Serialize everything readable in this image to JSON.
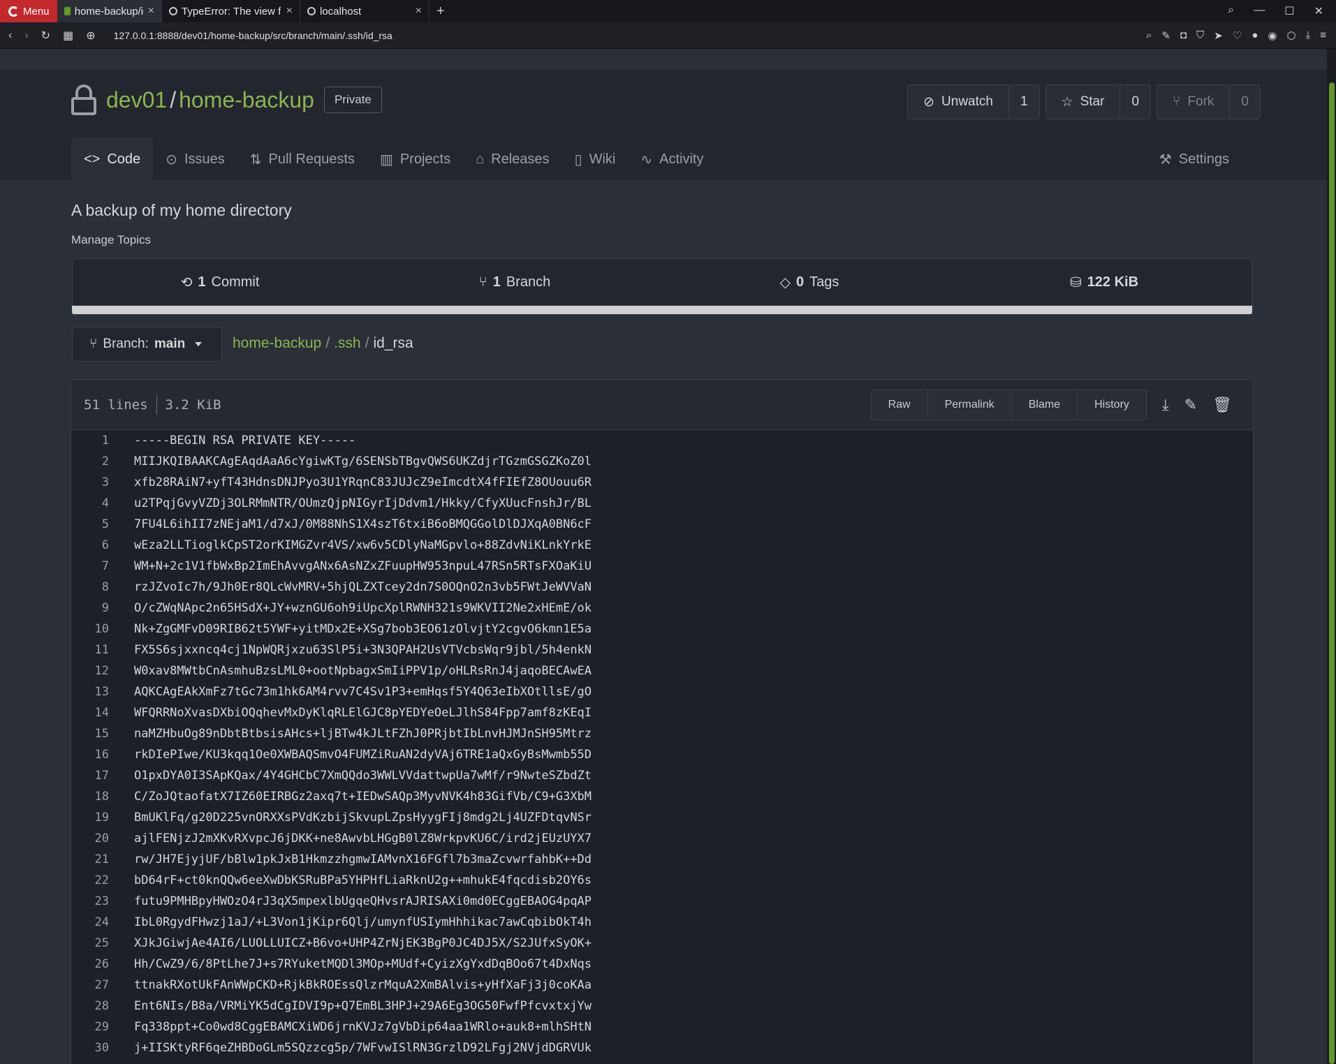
{
  "browser": {
    "menu_label": "Menu",
    "tabs": [
      {
        "title": "home-backup/id_rsa"
      },
      {
        "title": "TypeError: The view f"
      },
      {
        "title": "localhost"
      }
    ],
    "url": "127.0.0.1:8888/dev01/home-backup/src/branch/main/.ssh/id_rsa"
  },
  "repo": {
    "owner": "dev01",
    "name": "home-backup",
    "visibility": "Private",
    "unwatch_label": "Unwatch",
    "watch_count": "1",
    "star_label": "Star",
    "star_count": "0",
    "fork_label": "Fork",
    "fork_count": "0",
    "description": "A backup of my home directory",
    "manage_topics": "Manage Topics"
  },
  "nav": {
    "code": "Code",
    "issues": "Issues",
    "pulls": "Pull Requests",
    "projects": "Projects",
    "releases": "Releases",
    "wiki": "Wiki",
    "activity": "Activity",
    "settings": "Settings"
  },
  "stats": {
    "commits_num": "1",
    "commits_label": "Commit",
    "branches_num": "1",
    "branches_label": "Branch",
    "tags_num": "0",
    "tags_label": "Tags",
    "size": "122 KiB"
  },
  "branch": {
    "prefix": "Branch:",
    "name": "main"
  },
  "breadcrumb": {
    "root": "home-backup",
    "dir": ".ssh",
    "file": "id_rsa"
  },
  "file": {
    "lines": "51 lines",
    "size": "3.2 KiB",
    "raw": "Raw",
    "permalink": "Permalink",
    "blame": "Blame",
    "history": "History",
    "content": [
      "-----BEGIN RSA PRIVATE KEY-----",
      "MIIJKQIBAAKCAgEAqdAaA6cYgiwKTg/6SENSbTBgvQWS6UKZdjrTGzmGSGZKoZ0l",
      "xfb28RAiN7+yfT43HdnsDNJPyo3U1YRqnC83JUJcZ9eImcdtX4fFIEfZ8OUouu6R",
      "u2TPqjGvyVZDj3OLRMmNTR/OUmzQjpNIGyrIjDdvm1/Hkky/CfyXUucFnshJr/BL",
      "7FU4L6ihII7zNEjaM1/d7xJ/0M88NhS1X4szT6txiB6oBMQGGolDlDJXqA0BN6cF",
      "wEza2LLTioglkCpST2orKIMGZvr4VS/xw6v5CDlyNaMGpvlo+88ZdvNiKLnkYrkE",
      "WM+N+2c1V1fbWxBp2ImEhAvvgANx6AsNZxZFuupHW953npuL47RSn5RTsFXOaKiU",
      "rzJZvoIc7h/9Jh0Er8QLcWvMRV+5hjQLZXTcey2dn7S0OQnO2n3vb5FWtJeWVVaN",
      "O/cZWqNApc2n65HSdX+JY+wznGU6oh9iUpcXplRWNH321s9WKVII2Ne2xHEmE/ok",
      "Nk+ZgGMFvD09RIB62t5YWF+yitMDx2E+XSg7bob3EO61zOlvjtY2cgvO6kmn1E5a",
      "FX5S6sjxxncq4cj1NpWQRjxzu63SlP5i+3N3QPAH2UsVTVcbsWqr9jbl/5h4enkN",
      "W0xav8MWtbCnAsmhuBzsLML0+ootNpbagxSmIiPPV1p/oHLRsRnJ4jaqoBECAwEA",
      "AQKCAgEAkXmFz7tGc73m1hk6AM4rvv7C4Sv1P3+emHqsf5Y4Q63eIbXOtllsE/gO",
      "WFQRRNoXvasDXbiOQqhevMxDyKlqRLElGJC8pYEDYeOeLJlhS84Fpp7amf8zKEqI",
      "naMZHbuOg89nDbtBtbsisAHcs+ljBTw4kJLtFZhJ0PRjbtIbLnvHJMJnSH95Mtrz",
      "rkDIePIwe/KU3kqq1Oe0XWBAQSmvO4FUMZiRuAN2dyVAj6TRE1aQxGyBsMwmb55D",
      "O1pxDYA0I3SApKQax/4Y4GHCbC7XmQQdo3WWLVVdattwpUa7wMf/r9NwteSZbdZt",
      "C/ZoJQtaofatX7IZ60EIRBGz2axq7t+IEDwSAQp3MyvNVK4h83GifVb/C9+G3XbM",
      "BmUKlFq/g20D225vnORXXsPVdKzbijSkvupLZpsHyygFIj8mdg2Lj4UZFDtqvNSr",
      "ajlFENjzJ2mXKvRXvpcJ6jDKK+ne8AwvbLHGgB0lZ8WrkpvKU6C/ird2jEUzUYX7",
      "rw/JH7EjyjUF/bBlw1pkJxB1HkmzzhgmwIAMvnX16FGfl7b3maZcvwrfahbK++Dd",
      "bD64rF+ct0knQQw6eeXwDbKSRuBPa5YHPHfLiaRknU2g++mhukE4fqcdisb2OY6s",
      "futu9PMHBpyHWOzO4rJ3qX5mpexlbUgqeQHvsrAJRISAXi0md0ECggEBAOG4pqAP",
      "IbL0RgydFHwzj1aJ/+L3Von1jKipr6Qlj/umynfUSIymHhhikac7awCqbibOkT4h",
      "XJkJGiwjAe4AI6/LUOLLUICZ+B6vo+UHP4ZrNjEK3BgP0JC4DJ5X/S2JUfxSyOK+",
      "Hh/CwZ9/6/8PtLhe7J+s7RYuketMQDl3MOp+MUdf+CyizXgYxdDqBOo67t4DxNqs",
      "ttnakRXotUkFAnWWpCKD+RjkBkROEssQlzrMquA2XmBAlvis+yHfXaFj3j0coKAa",
      "Ent6NIs/B8a/VRMiYK5dCgIDVI9p+Q7EmBL3HPJ+29A6Eg3OG50FwfPfcvxtxjYw",
      "Fq338ppt+Co0wd8CggEBAMCXiWD6jrnKVJz7gVbDip64aa1WRlo+auk8+mlhSHtN",
      "j+IISKtyRF6qeZHBDoGLm5SQzzcg5p/7WFvwISlRN3GrzlD92LFgj2NVjdDGRVUk"
    ]
  }
}
